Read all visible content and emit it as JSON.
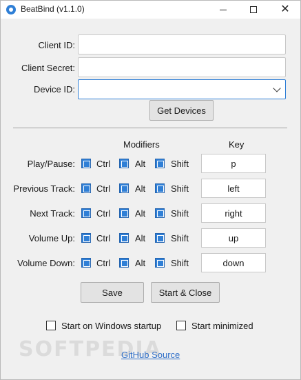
{
  "window": {
    "title": "BeatBind (v1.1.0)"
  },
  "form": {
    "client_id_label": "Client ID:",
    "client_id_value": "",
    "client_secret_label": "Client Secret:",
    "client_secret_value": "",
    "device_id_label": "Device ID:",
    "device_id_value": "",
    "get_devices_label": "Get Devices"
  },
  "hotkeys": {
    "modifiers_header": "Modifiers",
    "key_header": "Key",
    "modifier_labels": {
      "ctrl": "Ctrl",
      "alt": "Alt",
      "shift": "Shift"
    },
    "rows": [
      {
        "label": "Play/Pause:",
        "ctrl": true,
        "alt": true,
        "shift": true,
        "key": "p"
      },
      {
        "label": "Previous Track:",
        "ctrl": true,
        "alt": true,
        "shift": true,
        "key": "left"
      },
      {
        "label": "Next Track:",
        "ctrl": true,
        "alt": true,
        "shift": true,
        "key": "right"
      },
      {
        "label": "Volume Up:",
        "ctrl": true,
        "alt": true,
        "shift": true,
        "key": "up"
      },
      {
        "label": "Volume Down:",
        "ctrl": true,
        "alt": true,
        "shift": true,
        "key": "down"
      }
    ]
  },
  "actions": {
    "save_label": "Save",
    "start_close_label": "Start & Close"
  },
  "options": {
    "startup_label": "Start on Windows startup",
    "startup_checked": false,
    "minimized_label": "Start minimized",
    "minimized_checked": false
  },
  "footer": {
    "link_label": "GitHub Source",
    "watermark": "SOFTPEDIA"
  },
  "colors": {
    "accent": "#2f7fd6",
    "link": "#2f6fc8",
    "background": "#f0f0f0"
  }
}
